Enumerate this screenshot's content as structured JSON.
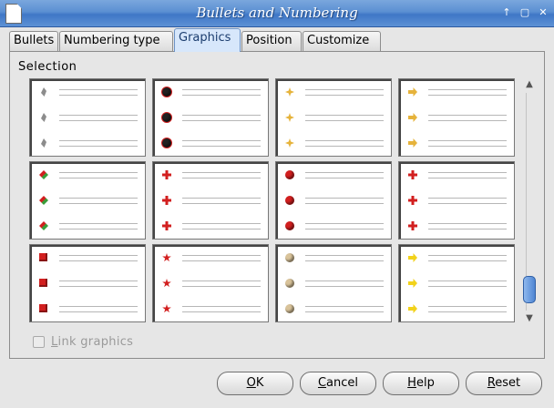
{
  "window": {
    "title": "Bullets and Numbering"
  },
  "window_controls": [
    "↑",
    "▢",
    "✕"
  ],
  "tabs": [
    {
      "label": "Bullets",
      "active": false
    },
    {
      "label": "Numbering type",
      "active": false
    },
    {
      "label": "Graphics",
      "active": true
    },
    {
      "label": "Position",
      "active": false
    },
    {
      "label": "Customize",
      "active": false
    }
  ],
  "section": {
    "title": "Selection"
  },
  "gallery": {
    "rows": [
      [
        "grey-pin-bullet-icon",
        "black-ball-bullet-icon",
        "gold-flower-bullet-icon",
        "gold-arrow-bullet-icon"
      ],
      [
        "green-red-diamond-bullet-icon",
        "red-cross-bullet-icon",
        "red-ball-bullet-icon",
        "red-cross-small-bullet-icon"
      ],
      [
        "red-cube-bullet-icon",
        "red-star-bullet-icon",
        "beige-ball-bullet-icon",
        "yellow-arrow-bullet-icon"
      ]
    ],
    "colors": {
      "grey": "#8c8c8c",
      "black": "#222222",
      "gold": "#e6b33b",
      "red": "#d21f1f",
      "green": "#3a9d3a",
      "beige": "#d9c39a",
      "yellow": "#f2d21a"
    }
  },
  "link_graphics": {
    "label": "Link graphics",
    "checked": false,
    "enabled": false
  },
  "buttons": {
    "ok": "OK",
    "cancel": "Cancel",
    "help": "Help",
    "reset": "Reset"
  }
}
